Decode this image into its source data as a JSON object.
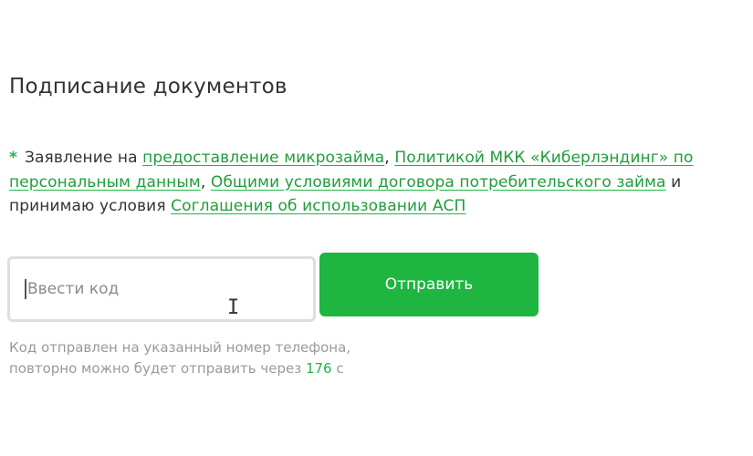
{
  "title": "Подписание документов",
  "agreement": {
    "asterisk": "*",
    "text_1": "Заявление на ",
    "link_1": "предоставление микрозайма",
    "sep_1": ", ",
    "link_2": "Политикой МКК «Киберлэндинг» по персональным данным",
    "sep_2": ", ",
    "link_3": "Общими условиями договора потребительского займа",
    "text_2": " и принимаю условия ",
    "link_4": "Соглашения об использовании АСП"
  },
  "code_input": {
    "placeholder": "Ввести код",
    "value": ""
  },
  "submit_button": {
    "label": "Отправить"
  },
  "hint": {
    "line_1": "Код отправлен на указанный номер телефона,",
    "line_2_prefix": "повторно можно будет отправить через ",
    "seconds": "176",
    "line_2_suffix": " с"
  },
  "colors": {
    "accent": "#1fb541",
    "link": "#1e9e3a",
    "text": "#333333",
    "muted": "#9a9a9a"
  },
  "icons": {
    "cursor": "text-cursor-icon"
  }
}
